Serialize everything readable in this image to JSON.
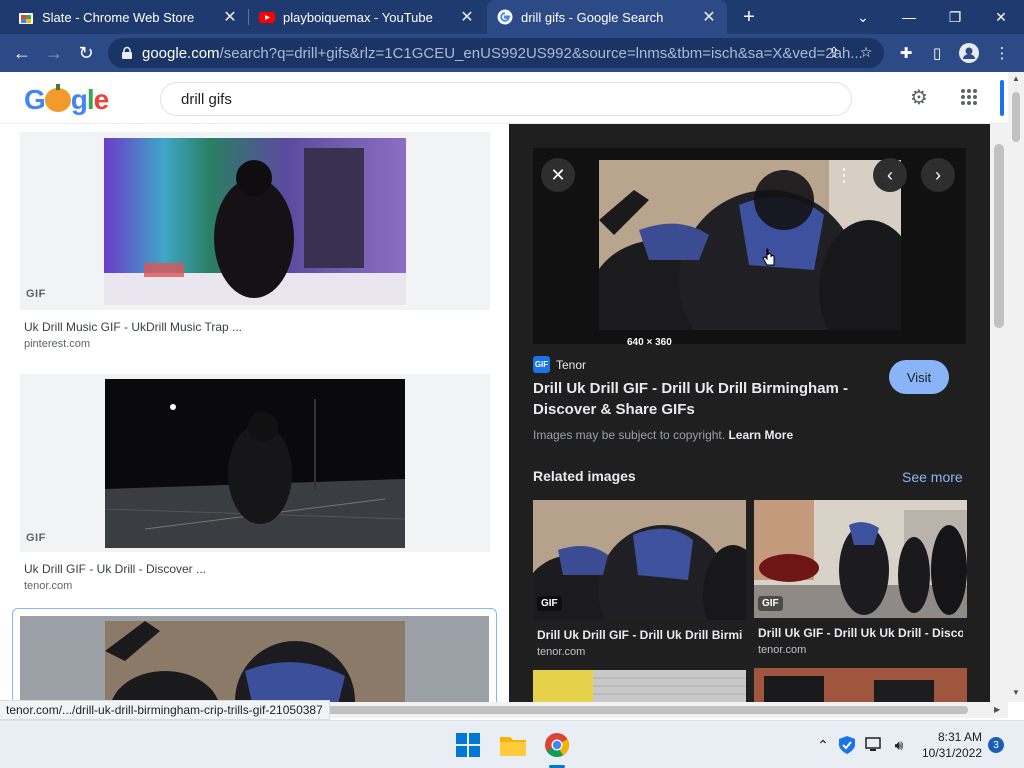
{
  "tabs": [
    {
      "title": "Slate - Chrome Web Store",
      "icon": "chrome-web-store-icon",
      "active": false
    },
    {
      "title": "playboiquemax - YouTube",
      "icon": "youtube-icon",
      "active": false
    },
    {
      "title": "drill gifs - Google Search",
      "icon": "google-icon",
      "active": true
    }
  ],
  "address": {
    "domain": "google.com",
    "path": "/search?q=drill+gifs&rlz=1C1GCEU_enUS992US992&source=lnms&tbm=isch&sa=X&ved=2ah..."
  },
  "search": {
    "query": "drill gifs"
  },
  "results": [
    {
      "badge": "GIF",
      "title": "Uk Drill Music GIF - UkDrill Music Trap ...",
      "source": "pinterest.com"
    },
    {
      "badge": "GIF",
      "title": "Uk Drill GIF - Uk Drill - Discover ...",
      "source": "tenor.com"
    }
  ],
  "preview": {
    "dimensions": "640 × 360",
    "source_name": "Tenor",
    "source_logo": "GIF",
    "title": "Drill Uk Drill GIF - Drill Uk Drill Birmingham - Discover & Share GIFs",
    "visit_label": "Visit",
    "copyright": "Images may be subject to copyright.",
    "learn_more": "Learn More",
    "related_heading": "Related images",
    "see_more": "See more",
    "related": [
      {
        "badge": "GIF",
        "title": "Drill Uk Drill GIF - Drill Uk Drill Birmi...",
        "source": "tenor.com"
      },
      {
        "badge": "GIF",
        "title": "Drill Uk GIF - Drill Uk Uk Drill - Disco...",
        "source": "tenor.com"
      }
    ]
  },
  "status_url": "tenor.com/.../drill-uk-drill-birmingham-crip-trills-gif-21050387",
  "taskbar": {
    "time": "8:31 AM",
    "date": "10/31/2022",
    "notifications": "3"
  },
  "colors": {
    "chrome_frame": "#1e3a6e",
    "chrome_toolbar": "#2b4a86",
    "preview_bg": "#1f1f1f",
    "link_blue": "#8ab4f8"
  }
}
